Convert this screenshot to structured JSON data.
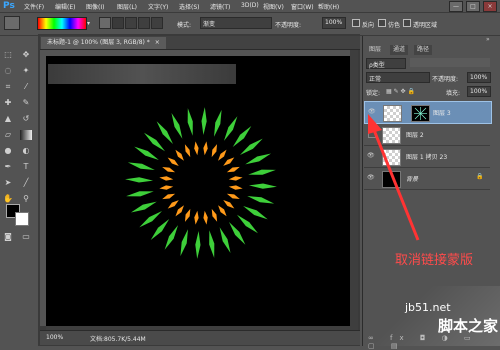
{
  "app": {
    "logo": "Ps"
  },
  "menu": [
    "文件(F)",
    "编辑(E)",
    "图像(I)",
    "图层(L)",
    "文字(Y)",
    "选择(S)",
    "滤镜(T)",
    "3D(D)",
    "视图(V)",
    "窗口(W)",
    "帮助(H)"
  ],
  "window_controls": [
    "—",
    "□",
    "×"
  ],
  "options": {
    "mode_label": "模式:",
    "mode_value": "渐变",
    "opacity_label": "不透明度:",
    "opacity_value": "100%",
    "reverse_label": "反向",
    "dither_label": "仿色",
    "transparency_label": "透明区域"
  },
  "document": {
    "tab_title": "未标题-1 @ 100% (图层 3, RGB/8) *",
    "tab_close": "×",
    "zoom": "100%",
    "doc_info": "文档:805.7K/5.44M"
  },
  "layers_panel": {
    "tabs": [
      "图层",
      "通道",
      "路径"
    ],
    "kind_label": "ρ类型",
    "blend_mode": "正常",
    "opacity_label": "不透明度:",
    "opacity_value": "100%",
    "lock_label": "锁定:",
    "fill_label": "填充:",
    "fill_value": "100%",
    "layers": [
      {
        "name": "图层 3",
        "selected": true
      },
      {
        "name": "图层 2",
        "selected": false
      },
      {
        "name": "图层 1 拷贝 23",
        "selected": false
      },
      {
        "name": "背景",
        "selected": false
      }
    ]
  },
  "annotation": {
    "text": "取消链接蒙版",
    "color": "#ff4b4b"
  },
  "watermark": {
    "left": "jb51.net",
    "right": "脚本之家"
  },
  "colors": {
    "spike_green": "#3ecf3a",
    "spike_orange": "#ff9a1a",
    "panel_bg": "#535353",
    "selected_layer": "#6b8fb6"
  }
}
